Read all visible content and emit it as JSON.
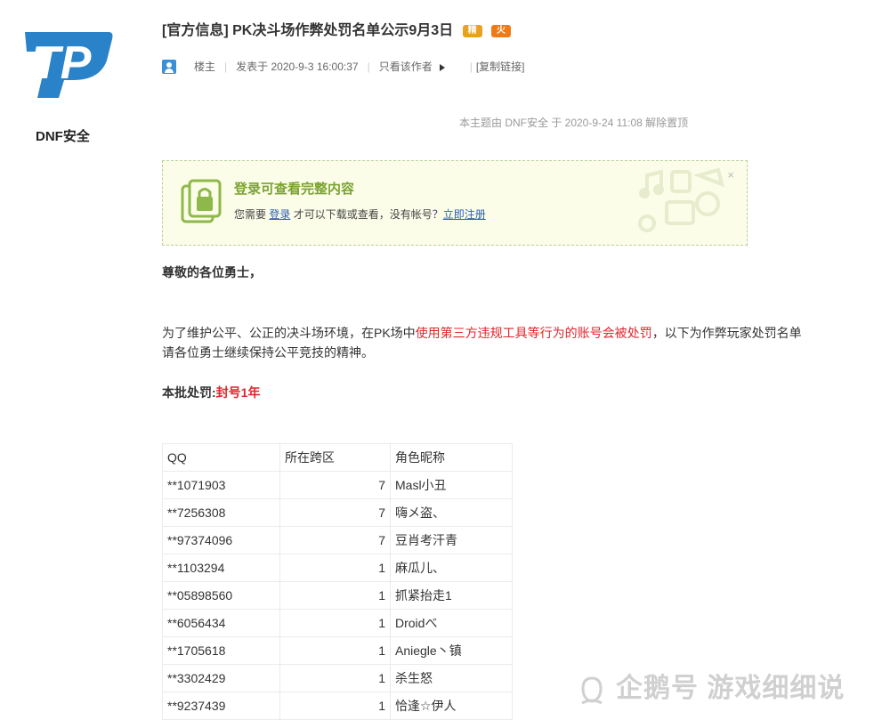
{
  "author": {
    "name": "DNF安全"
  },
  "post": {
    "title": "[官方信息] PK决斗场作弊处罚名单公示9月3日",
    "badges": [
      "精",
      "火"
    ],
    "floor_label": "楼主",
    "posted": "发表于 2020-9-3 16:00:37",
    "only_author": "只看该作者",
    "copy_link": "[复制链接]",
    "sticky_note": "本主题由 DNF安全 于 2020-9-24 11:08 解除置顶"
  },
  "login_notice": {
    "title": "登录可查看完整内容",
    "text_before": "您需要 ",
    "login_link": "登录",
    "text_middle": " 才可以下载或查看，没有帐号？",
    "register_link": "立即注册",
    "close": "×"
  },
  "content": {
    "greeting": "尊敬的各位勇士，",
    "para_line1_before": "为了维护公平、公正的决斗场环境，在PK场中",
    "para_line1_red": "使用第三方违规工具等行为的账号会被处罚",
    "para_line1_after": "，以下为作弊玩家处罚名单",
    "para_line2": "请各位勇士继续保持公平竞技的精神。",
    "punish_label": "本批处罚:",
    "punish_value": "封号1年"
  },
  "table": {
    "headers": [
      "QQ",
      "所在跨区",
      "角色昵称"
    ],
    "rows": [
      [
        "**1071903",
        "7",
        "Masl小丑"
      ],
      [
        "**7256308",
        "7",
        "嗨メ盗、"
      ],
      [
        "**97374096",
        "7",
        "豆肖考汗青"
      ],
      [
        "**1103294",
        "1",
        "麻瓜儿、"
      ],
      [
        "**05898560",
        "1",
        "抓紧抬走1"
      ],
      [
        "**6056434",
        "1",
        "Droidべ"
      ],
      [
        "**1705618",
        "1",
        "Aniegle丶镇"
      ],
      [
        "**3302429",
        "1",
        "杀生怒"
      ],
      [
        "**9237439",
        "1",
        "恰逢☆伊人"
      ]
    ]
  },
  "watermark": "企鹅号 游戏细细说",
  "colors": {
    "logo_blue": "#2a82c9",
    "accent_green": "#7ba331",
    "link_blue": "#2a5fb0",
    "alert_red": "#e0262d"
  }
}
